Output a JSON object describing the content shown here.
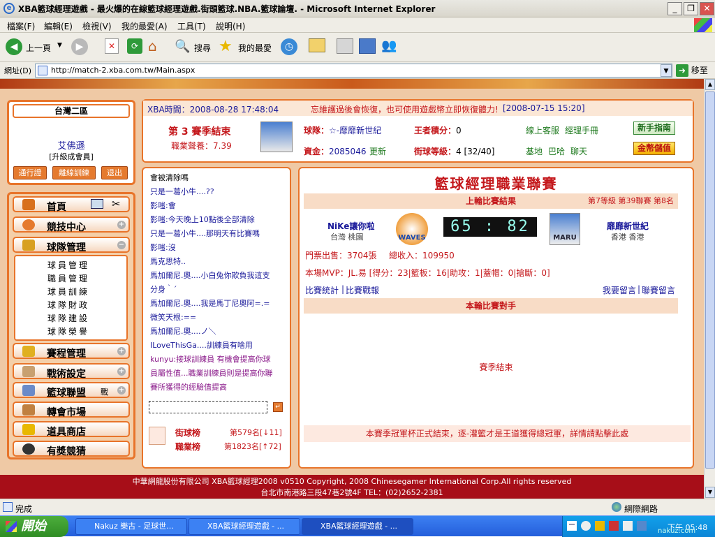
{
  "window": {
    "title": "XBA籃球經理遊戲 - 最火爆的在線籃球經理遊戲.街頭籃球.NBA.籃球論壇. - Microsoft Internet Explorer",
    "min": "_",
    "max": "❐",
    "close": "✕"
  },
  "menu": [
    "檔案(F)",
    "編輯(E)",
    "檢視(V)",
    "我的最愛(A)",
    "工具(T)",
    "說明(H)"
  ],
  "toolbar": {
    "back": "上一頁",
    "search": "搜尋",
    "favorites": "我的最愛"
  },
  "address": {
    "label": "網址(D)",
    "url": "http://match-2.xba.com.tw/Main.aspx",
    "go": "移至"
  },
  "user": {
    "region": "台灣二區",
    "name": "艾佛遜",
    "level": "[升級成會員]",
    "buttons": [
      "通行證",
      "離線訓練",
      "退出"
    ]
  },
  "nav": {
    "items": [
      "首頁",
      "競技中心",
      "球隊管理",
      "賽程管理",
      "戰術設定",
      "籃球聯盟",
      "轉會市場",
      "道具商店",
      "有獎競猜"
    ],
    "league_suffix": "戰",
    "sub_items": [
      "球員管理",
      "職員管理",
      "球員訓練",
      "球隊財政",
      "球隊建設",
      "球隊榮譽"
    ]
  },
  "info": {
    "xba_time": "XBA時間：2008-08-28 17:48:04",
    "notice": "忘維護過後會恢復，也可使用遊戲幣立即恢復體力!",
    "notice_date": "[2008-07-15 15:20]",
    "season_label": "第 3 賽季結束",
    "career_label": "職業聲養：7.39",
    "team_label": "球隊：",
    "team_name": "☆-靡靡新世紀",
    "king_label": "王者積分：",
    "king_value": "0",
    "cs_label": "線上客服",
    "manual_label": "經理手冊",
    "money_label": "資金：",
    "money_value": "2085046",
    "refresh": "更新",
    "team_level_label": "街球等級：",
    "team_level_value": "4 [32/40]",
    "base_label": "基地",
    "bar_label": "巴哈",
    "chat_label": "聊天",
    "newbie_button": "新手指南",
    "coin_button": "金幣儲值"
  },
  "chat": {
    "messages": [
      {
        "text": "會被清除嗎",
        "color": "#000"
      },
      {
        "text": "只是一葛小牛....??",
        "color": "#1a1a9a"
      },
      {
        "text": "影嗤:會",
        "color": "#1a1a9a"
      },
      {
        "text": "影嗤:今天晚上10點後全部清除",
        "color": "#1a1a9a"
      },
      {
        "text": "只是一葛小牛....那明天有比賽嗎",
        "color": "#1a1a9a"
      },
      {
        "text": "影嗤:沒",
        "color": "#1a1a9a"
      },
      {
        "text": "馬克思特..",
        "color": "#1a1a9a"
      },
      {
        "text": "馬加爾尼.奧....小白兔你欺負我這支",
        "color": "#1a1a9a"
      },
      {
        "text": "分身｀´",
        "color": "#1a1a9a"
      },
      {
        "text": "馬加爾尼.奧....我是馬丁尼奧阿=.=",
        "color": "#1a1a9a"
      },
      {
        "text": "微笑天根:==",
        "color": "#1a1a9a"
      },
      {
        "text": "馬加爾尼.奧....ノ＼",
        "color": "#1a1a9a"
      },
      {
        "text": "ILoveThisGa....訓練員有啥用",
        "color": "#1a1a9a"
      },
      {
        "text": "kunyu:接球訓練員  有機會提高你球",
        "color": "#8a1a8a"
      },
      {
        "text": "員屬性值...職業訓練員則是提高你聯",
        "color": "#8a1a8a"
      },
      {
        "text": "賽所獲得的經驗值提高",
        "color": "#8a1a8a"
      }
    ],
    "rank_street_label": "街球榜",
    "rank_street_value": "第579名[↓11]",
    "rank_career_label": "職業榜",
    "rank_career_value": "第1823名[↑72]"
  },
  "match": {
    "league_title": "籃球經理職業聯賽",
    "last_result": "上輪比賽結果",
    "level_info": "第7等級  第39聯賽  第8名",
    "home_team": "NiKe讓你啦",
    "home_loc": "台灣  桃園",
    "home_logo": "WAVES",
    "score": "65 : 82",
    "away_team": "靡靡新世紀",
    "away_loc": "香港  香港",
    "away_logo": "MARU",
    "tickets": "門票出售：3704張",
    "income": "總收入：109950",
    "mvp": "本場MVP：JL.易  [得分：23|籃板：16|助攻：1|蓋帽：0|搶斷：0]",
    "stats_link": "比賽統計",
    "report_link": "比賽戰報",
    "msg_link": "我要留言",
    "league_msg_link": "聯賽留言",
    "opponent_header": "本輪比賽對手",
    "season_end": "賽季結束",
    "champion_msg": "本賽季冠軍杯正式結束，逐-灌籃才是王道獲得總冠軍，詳情請點擊此處"
  },
  "footer": {
    "line1": "中華網龍股份有限公司  XBA籃球經理2008 v0510     Copyright, 2008 Chinesegamer International Corp.All rights reserved",
    "line2": "台北市南港路三段47巷2號4F TEL：(02)2652-2381"
  },
  "status": {
    "text": "完成",
    "zone": "網際網路"
  },
  "taskbar": {
    "start": "開始",
    "tasks": [
      "Nakuz 樂古 - 足球世...",
      "XBA籃球經理遊戲 - ...",
      "XBA籃球經理遊戲 - ..."
    ],
    "clock": "下午 05:48",
    "watermark": "nakuz.com"
  }
}
